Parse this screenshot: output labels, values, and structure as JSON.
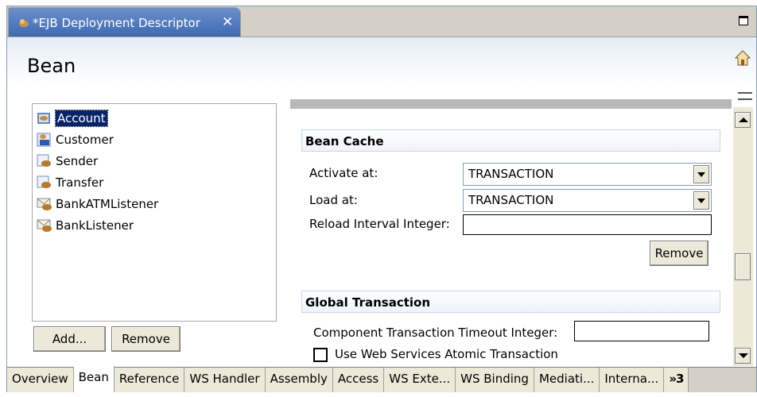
{
  "editor_tab": {
    "title": "*EJB Deployment Descriptor",
    "close_glyph": "✕"
  },
  "page": {
    "title": "Bean"
  },
  "beans": [
    {
      "label": "Account",
      "icon": "entity-bean-icon",
      "selected": true
    },
    {
      "label": "Customer",
      "icon": "entity-bean-2-1-icon",
      "selected": false
    },
    {
      "label": "Sender",
      "icon": "session-bean-icon",
      "selected": false
    },
    {
      "label": "Transfer",
      "icon": "session-bean-icon",
      "selected": false
    },
    {
      "label": "BankATMListener",
      "icon": "message-driven-bean-icon",
      "selected": false
    },
    {
      "label": "BankListener",
      "icon": "message-driven-bean-icon",
      "selected": false
    }
  ],
  "bean_buttons": {
    "add": "Add...",
    "remove": "Remove"
  },
  "bean_cache": {
    "title": "Bean Cache",
    "activate_label": "Activate at:",
    "activate_value": "TRANSACTION",
    "load_label": "Load at:",
    "load_value": "TRANSACTION",
    "reload_label": "Reload Interval Integer:",
    "reload_value": "",
    "remove_button": "Remove"
  },
  "global_transaction": {
    "title": "Global Transaction",
    "timeout_label": "Component Transaction Timeout Integer:",
    "timeout_value": "",
    "atomic_label": "Use Web Services Atomic Transaction",
    "atomic_checked": false
  },
  "bottom_tabs": [
    {
      "label": "Overview",
      "active": false
    },
    {
      "label": "Bean",
      "active": true
    },
    {
      "label": "Reference",
      "active": false
    },
    {
      "label": "WS Handler",
      "active": false
    },
    {
      "label": "Assembly",
      "active": false
    },
    {
      "label": "Access",
      "active": false
    },
    {
      "label": "WS Exte...",
      "active": false
    },
    {
      "label": "WS Binding",
      "active": false
    },
    {
      "label": "Mediati...",
      "active": false
    },
    {
      "label": "Interna...",
      "active": false
    }
  ],
  "more_tabs": {
    "label": "»3"
  },
  "colors": {
    "tab_blue": "#3d6ab4",
    "selection": "#0a246a",
    "section_border": "#c8d6e8"
  }
}
